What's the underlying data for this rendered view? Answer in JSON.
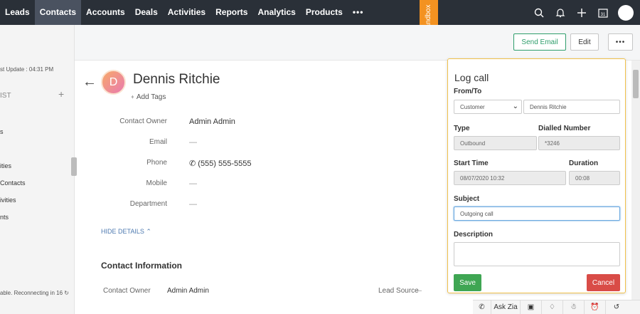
{
  "nav": {
    "tabs": [
      "Leads",
      "Contacts",
      "Accounts",
      "Deals",
      "Activities",
      "Reports",
      "Analytics",
      "Products",
      "•••"
    ],
    "active": "Contacts",
    "calendar_day": "31"
  },
  "sandbox": {
    "label": "Sandbox"
  },
  "sidebar": {
    "last_update": "st Update : 04:31 PM",
    "list_header": "IST",
    "items": [
      "s",
      "ities",
      "Contacts",
      "ivities",
      "nts"
    ],
    "status": "able. Reconnecting in 16"
  },
  "actions": {
    "send_email": "Send Email",
    "edit": "Edit",
    "more": "•••"
  },
  "contact": {
    "initial": "D",
    "name": "Dennis Ritchie",
    "add_tags": "Add Tags",
    "fields": [
      {
        "label": "Contact Owner",
        "value": "Admin Admin"
      },
      {
        "label": "Email",
        "value": "—"
      },
      {
        "label": "Phone",
        "value": "(555) 555-5555"
      },
      {
        "label": "Mobile",
        "value": "—"
      },
      {
        "label": "Department",
        "value": "—"
      }
    ],
    "hide_details": "HIDE DETAILS",
    "section_title": "Contact Information",
    "info": {
      "owner_label": "Contact Owner",
      "owner_value": "Admin Admin",
      "lead_source_label": "Lead Source",
      "lead_source_value": "—"
    }
  },
  "log_call": {
    "title": "Log call",
    "from_to_label": "From/To",
    "from_to_type": "Customer",
    "from_to_name": "Dennis Ritchie",
    "type_label": "Type",
    "type_value": "Outbound",
    "dialled_label": "Dialled Number",
    "dialled_value": "*3246",
    "start_label": "Start Time",
    "start_value": "08/07/2020 10:32",
    "duration_label": "Duration",
    "duration_value": "00:08",
    "subject_label": "Subject",
    "subject_value": "Outgoing call",
    "description_label": "Description",
    "description_value": "",
    "save": "Save",
    "cancel": "Cancel"
  },
  "bottombar": {
    "ask_zia": "Ask Zia"
  }
}
